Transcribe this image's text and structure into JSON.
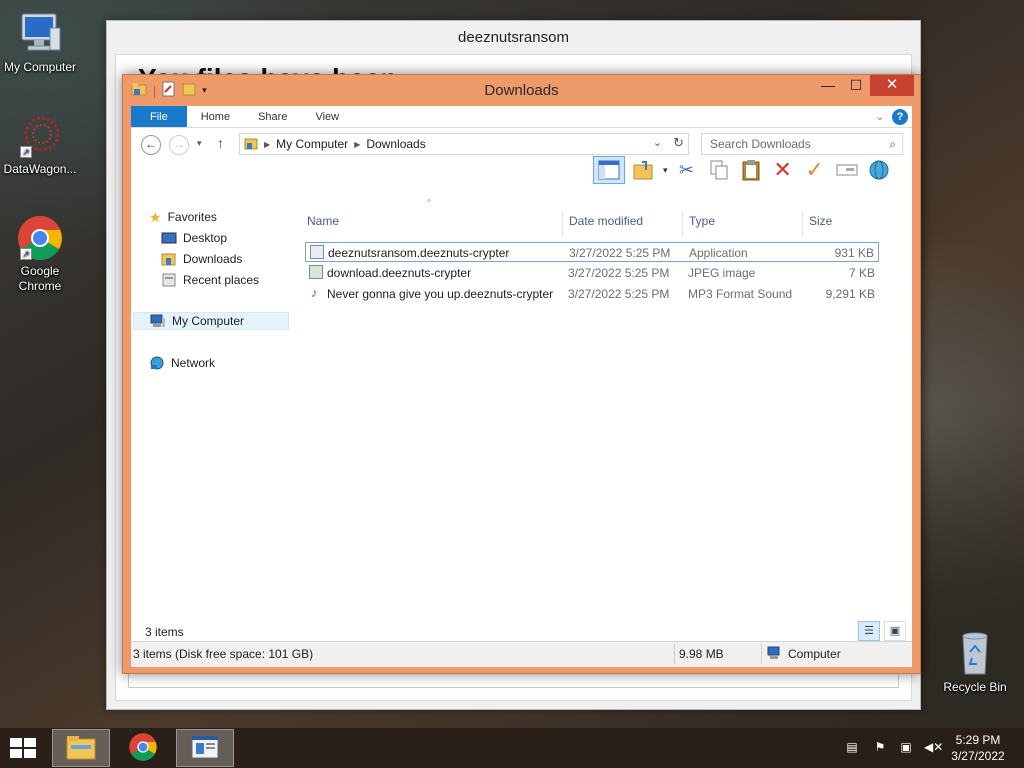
{
  "desktop": {
    "icons": [
      {
        "label": "My Computer"
      },
      {
        "label": "DataWagon..."
      },
      {
        "label": "Google Chrome"
      },
      {
        "label": "Recycle Bin"
      }
    ]
  },
  "ransom_window": {
    "title": "deeznutsransom",
    "heading": "You                         files have been                        "
  },
  "explorer": {
    "title": "Downloads",
    "ribbon_tabs": [
      "File",
      "Home",
      "Share",
      "View"
    ],
    "breadcrumb": [
      "My Computer",
      "Downloads"
    ],
    "search_placeholder": "Search Downloads",
    "nav": {
      "favorites": "Favorites",
      "desktop": "Desktop",
      "downloads": "Downloads",
      "recent": "Recent places",
      "computer": "My Computer",
      "network": "Network"
    },
    "columns": [
      "Name",
      "Date modified",
      "Type",
      "Size"
    ],
    "files": [
      {
        "name": "deeznutsransom.deeznuts-crypter",
        "date": "3/27/2022 5:25 PM",
        "type": "Application",
        "size": "931 KB"
      },
      {
        "name": "download.deeznuts-crypter",
        "date": "3/27/2022 5:25 PM",
        "type": "JPEG image",
        "size": "7 KB"
      },
      {
        "name": "Never gonna give you up.deeznuts-crypter",
        "date": "3/27/2022 5:25 PM",
        "type": "MP3 Format Sound",
        "size": "9,291 KB"
      }
    ],
    "items_count": "3 items",
    "status": {
      "left": "3 items (Disk free space: 101 GB)",
      "size": "9.98 MB",
      "location": "Computer"
    }
  },
  "taskbar": {
    "time": "5:29 PM",
    "date": "3/27/2022"
  },
  "colors": {
    "explorer_frame": "#ef9a6b",
    "file_tab": "#1979ca",
    "close_button": "#c7432f"
  }
}
